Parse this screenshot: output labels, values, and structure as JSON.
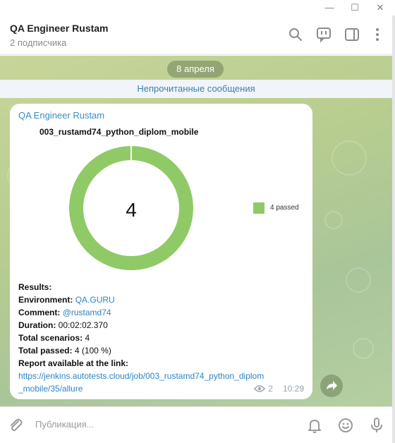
{
  "window": {
    "minimize": "—",
    "maximize": "☐",
    "close": "✕"
  },
  "chat": {
    "title": "QA Engineer Rustam",
    "subtitle": "2 подписчика",
    "icons": [
      "search-icon",
      "discussion-icon",
      "sidebar-toggle-icon",
      "more-icon"
    ]
  },
  "feed": {
    "date": "8 апреля",
    "unread": "Непрочитанные сообщения"
  },
  "message": {
    "sender": "QA Engineer Rustam",
    "report_title": "003_rustamd74_python_diplom_mobile",
    "donut_center": "4",
    "legend": "4 passed",
    "results_label": "Results:",
    "environment_label": "Environment:",
    "environment_value": "QA.GURU",
    "comment_label": "Comment:",
    "comment_value": "@rustamd74",
    "duration_label": "Duration:",
    "duration_value": "00:02:02.370",
    "scenarios_label": "Total scenarios:",
    "scenarios_value": "4",
    "passed_label": "Total passed:",
    "passed_value": "4 (100 %)",
    "report_label": "Report available at the link:",
    "report_url_1": "https://jenkins.autotests.cloud/job/003_rustamd74_python_diplom",
    "report_url_2": "_mobile/35/allure",
    "views": "2",
    "time": "10:29"
  },
  "chart_data": {
    "type": "pie",
    "categories": [
      "passed"
    ],
    "values": [
      4
    ],
    "colors": [
      "#8fca67"
    ],
    "title": "003_rustamd74_python_diplom_mobile",
    "center_label": "4",
    "legend": "right"
  },
  "composer": {
    "placeholder": "Публикация..."
  },
  "colors": {
    "accent": "#3a8cc4",
    "passed": "#8fca67",
    "chat_background": "#b7cd8f"
  }
}
